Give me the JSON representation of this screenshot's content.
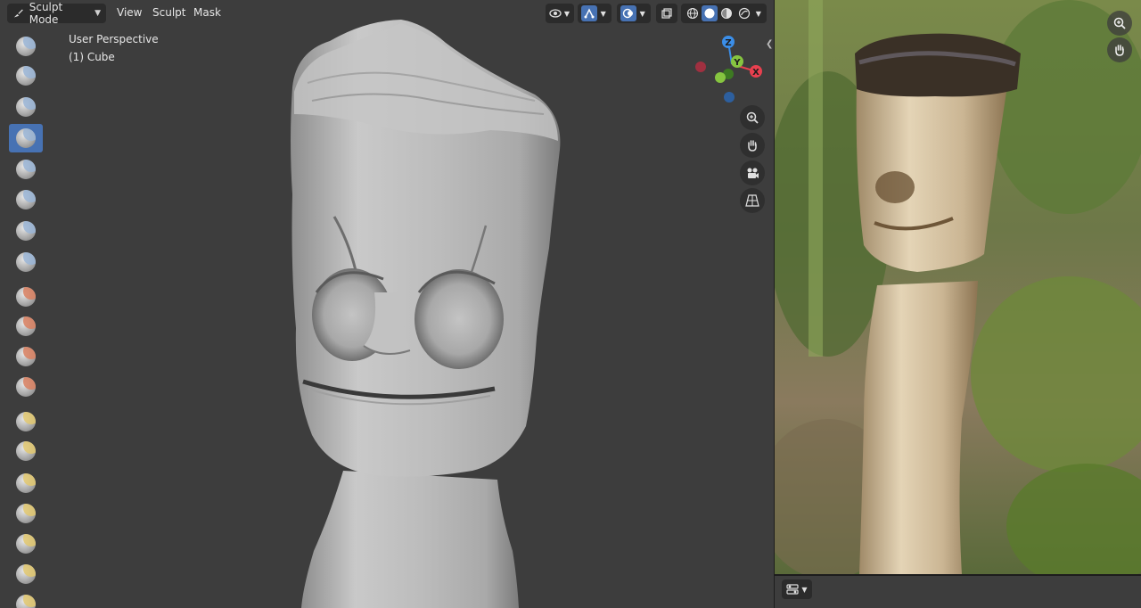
{
  "header": {
    "mode_label": "Sculpt Mode",
    "menus": [
      "View",
      "Sculpt",
      "Mask"
    ]
  },
  "viewport": {
    "view_name": "User Perspective",
    "object_name": "(1) Cube"
  },
  "toolbar": {
    "active_index": 3,
    "tools": [
      {
        "icon": "draw-brush-icon",
        "tint": "#9ab5d6"
      },
      {
        "icon": "draw-sharp-brush-icon",
        "tint": "#9ab5d6"
      },
      {
        "icon": "clay-brush-icon",
        "tint": "#9ab5d6"
      },
      {
        "icon": "clay-strips-brush-icon",
        "tint": "#9ab5d6"
      },
      {
        "icon": "clay-thumb-brush-icon",
        "tint": "#9ab5d6"
      },
      {
        "icon": "layer-brush-icon",
        "tint": "#9ab5d6"
      },
      {
        "icon": "inflate-brush-icon",
        "tint": "#9ab5d6"
      },
      {
        "icon": "blob-brush-icon",
        "tint": "#9ab5d6"
      },
      {
        "icon": "crease-brush-icon",
        "tint": "#d98060"
      },
      {
        "icon": "smooth-brush-icon",
        "tint": "#d98060"
      },
      {
        "icon": "flatten-brush-icon",
        "tint": "#d98060"
      },
      {
        "icon": "fill-brush-icon",
        "tint": "#d98060"
      },
      {
        "icon": "scrape-brush-icon",
        "tint": "#e2c870"
      },
      {
        "icon": "multiplane-scrape-brush-icon",
        "tint": "#e2c870"
      },
      {
        "icon": "pinch-brush-icon",
        "tint": "#e2c870"
      },
      {
        "icon": "grab-brush-icon",
        "tint": "#e2c870"
      },
      {
        "icon": "elastic-deform-brush-icon",
        "tint": "#e2c870"
      },
      {
        "icon": "snake-hook-brush-icon",
        "tint": "#e2c870"
      },
      {
        "icon": "thumb-brush-icon",
        "tint": "#e2c870"
      }
    ]
  },
  "gizmo": {
    "axes": {
      "x": "X",
      "y": "Y",
      "z": "Z"
    },
    "colors": {
      "x": "#e8404f",
      "y": "#86c540",
      "z": "#3b8ee8",
      "neg_x": "#a03040",
      "neg_y": "#6b9a38",
      "neg_z": "#2d5f9e"
    }
  },
  "nav_buttons": [
    "zoom-icon",
    "pan-hand-icon",
    "camera-icon",
    "perspective-grid-icon"
  ],
  "colors": {
    "accent": "#4772b3",
    "viewport_bg": "#3d3d3d",
    "header_bg": "#2b2b2b"
  }
}
